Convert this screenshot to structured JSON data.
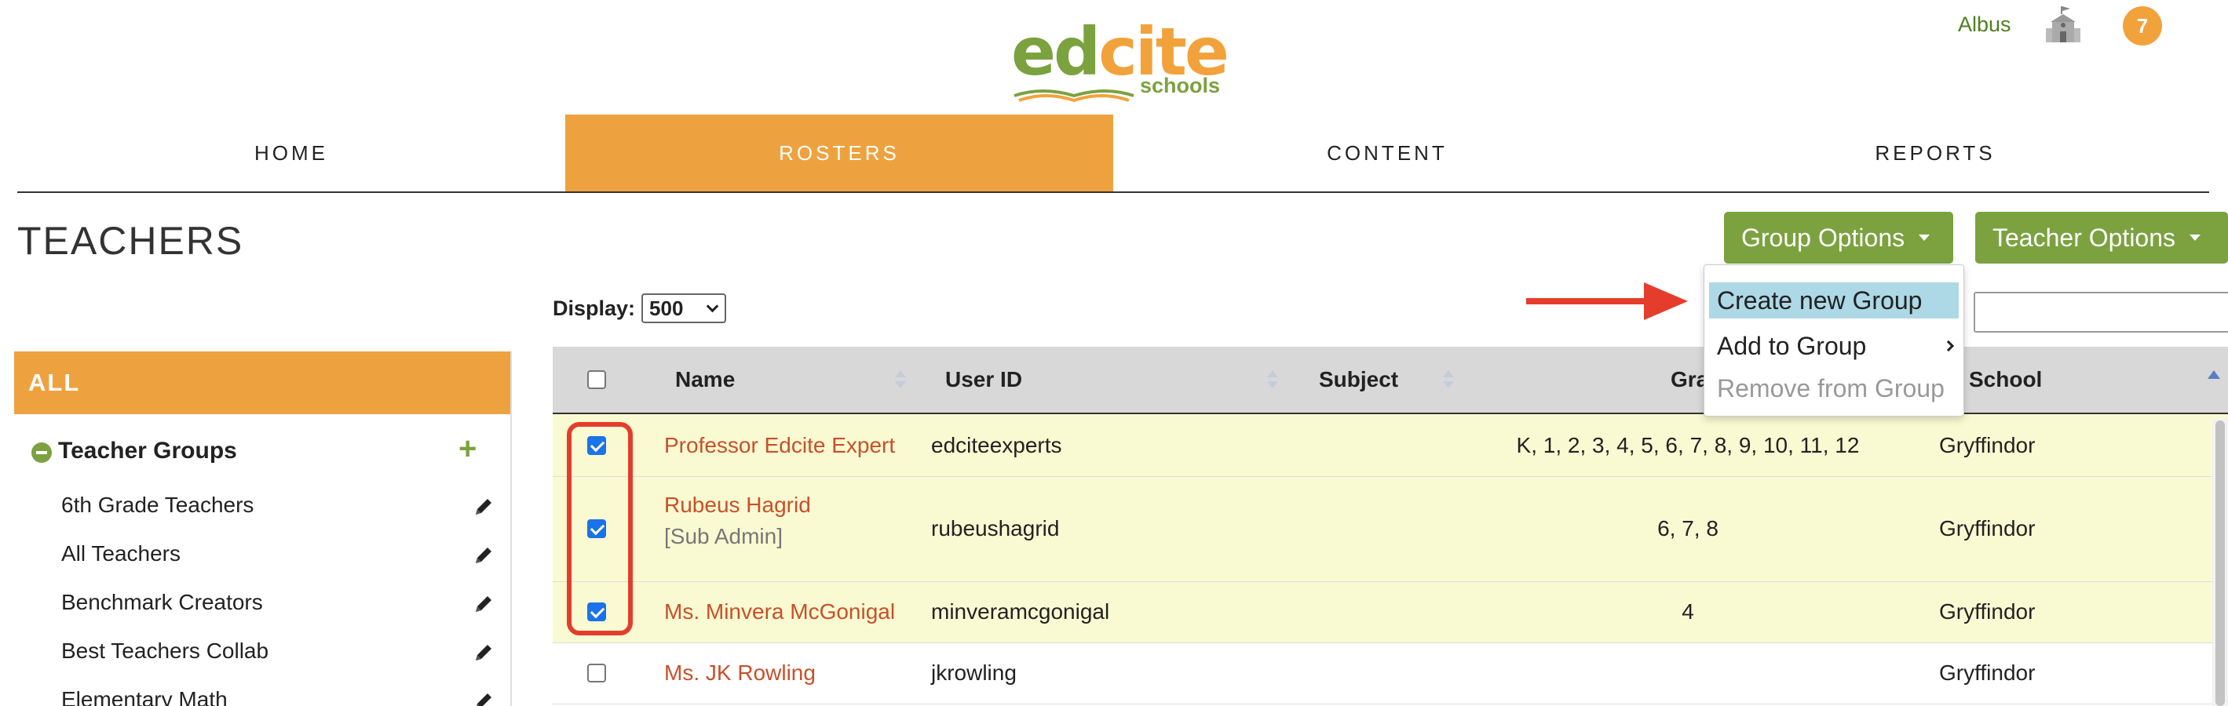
{
  "header": {
    "logo": {
      "word_left": "ed",
      "word_right": "cite",
      "subtitle": "schools"
    },
    "user_name": "Albus",
    "notification_count": "7"
  },
  "nav": {
    "items": [
      {
        "label": "HOME",
        "active": false
      },
      {
        "label": "ROSTERS",
        "active": true
      },
      {
        "label": "CONTENT",
        "active": false
      },
      {
        "label": "REPORTS",
        "active": false
      }
    ]
  },
  "page": {
    "title": "TEACHERS",
    "group_options_label": "Group Options",
    "teacher_options_label": "Teacher Options"
  },
  "group_menu": {
    "items": [
      {
        "label": "Create new Group",
        "state": "highlighted"
      },
      {
        "label": "Add to Group",
        "state": "submenu"
      },
      {
        "label": "Remove from Group",
        "state": "disabled"
      }
    ]
  },
  "display": {
    "label": "Display:",
    "value": "500"
  },
  "sidebar": {
    "all_label": "ALL",
    "groups_label": "Teacher Groups",
    "groups": [
      {
        "label": "6th Grade Teachers"
      },
      {
        "label": "All Teachers"
      },
      {
        "label": "Benchmark Creators"
      },
      {
        "label": "Best Teachers Collab"
      },
      {
        "label": "Elementary Math"
      }
    ]
  },
  "table": {
    "columns": {
      "name": "Name",
      "user_id": "User ID",
      "subject": "Subject",
      "grades": "Gra",
      "school": "School"
    },
    "rows": [
      {
        "name": "Professor Edcite Expert",
        "sub": "",
        "user_id": "edciteexperts",
        "subject": "",
        "grades": "K, 1, 2, 3, 4, 5, 6, 7, 8, 9, 10, 11, 12",
        "school": "Gryffindor",
        "checked": true
      },
      {
        "name": "Rubeus Hagrid",
        "sub": "[Sub Admin]",
        "user_id": "rubeushagrid",
        "subject": "",
        "grades": "6, 7, 8",
        "school": "Gryffindor",
        "checked": true
      },
      {
        "name": "Ms. Minvera McGonigal",
        "sub": "",
        "user_id": "minveramcgonigal",
        "subject": "",
        "grades": "4",
        "school": "Gryffindor",
        "checked": true
      },
      {
        "name": "Ms. JK Rowling",
        "sub": "",
        "user_id": "jkrowling",
        "subject": "",
        "grades": "",
        "school": "Gryffindor",
        "checked": false
      }
    ]
  },
  "colors": {
    "brand_green": "#7ba23f",
    "brand_orange": "#eea23f",
    "link_orange": "#c8502a",
    "selected_row": "#fafad2",
    "menu_highlight": "#add8e6",
    "annotation_red": "#e53d2b"
  }
}
